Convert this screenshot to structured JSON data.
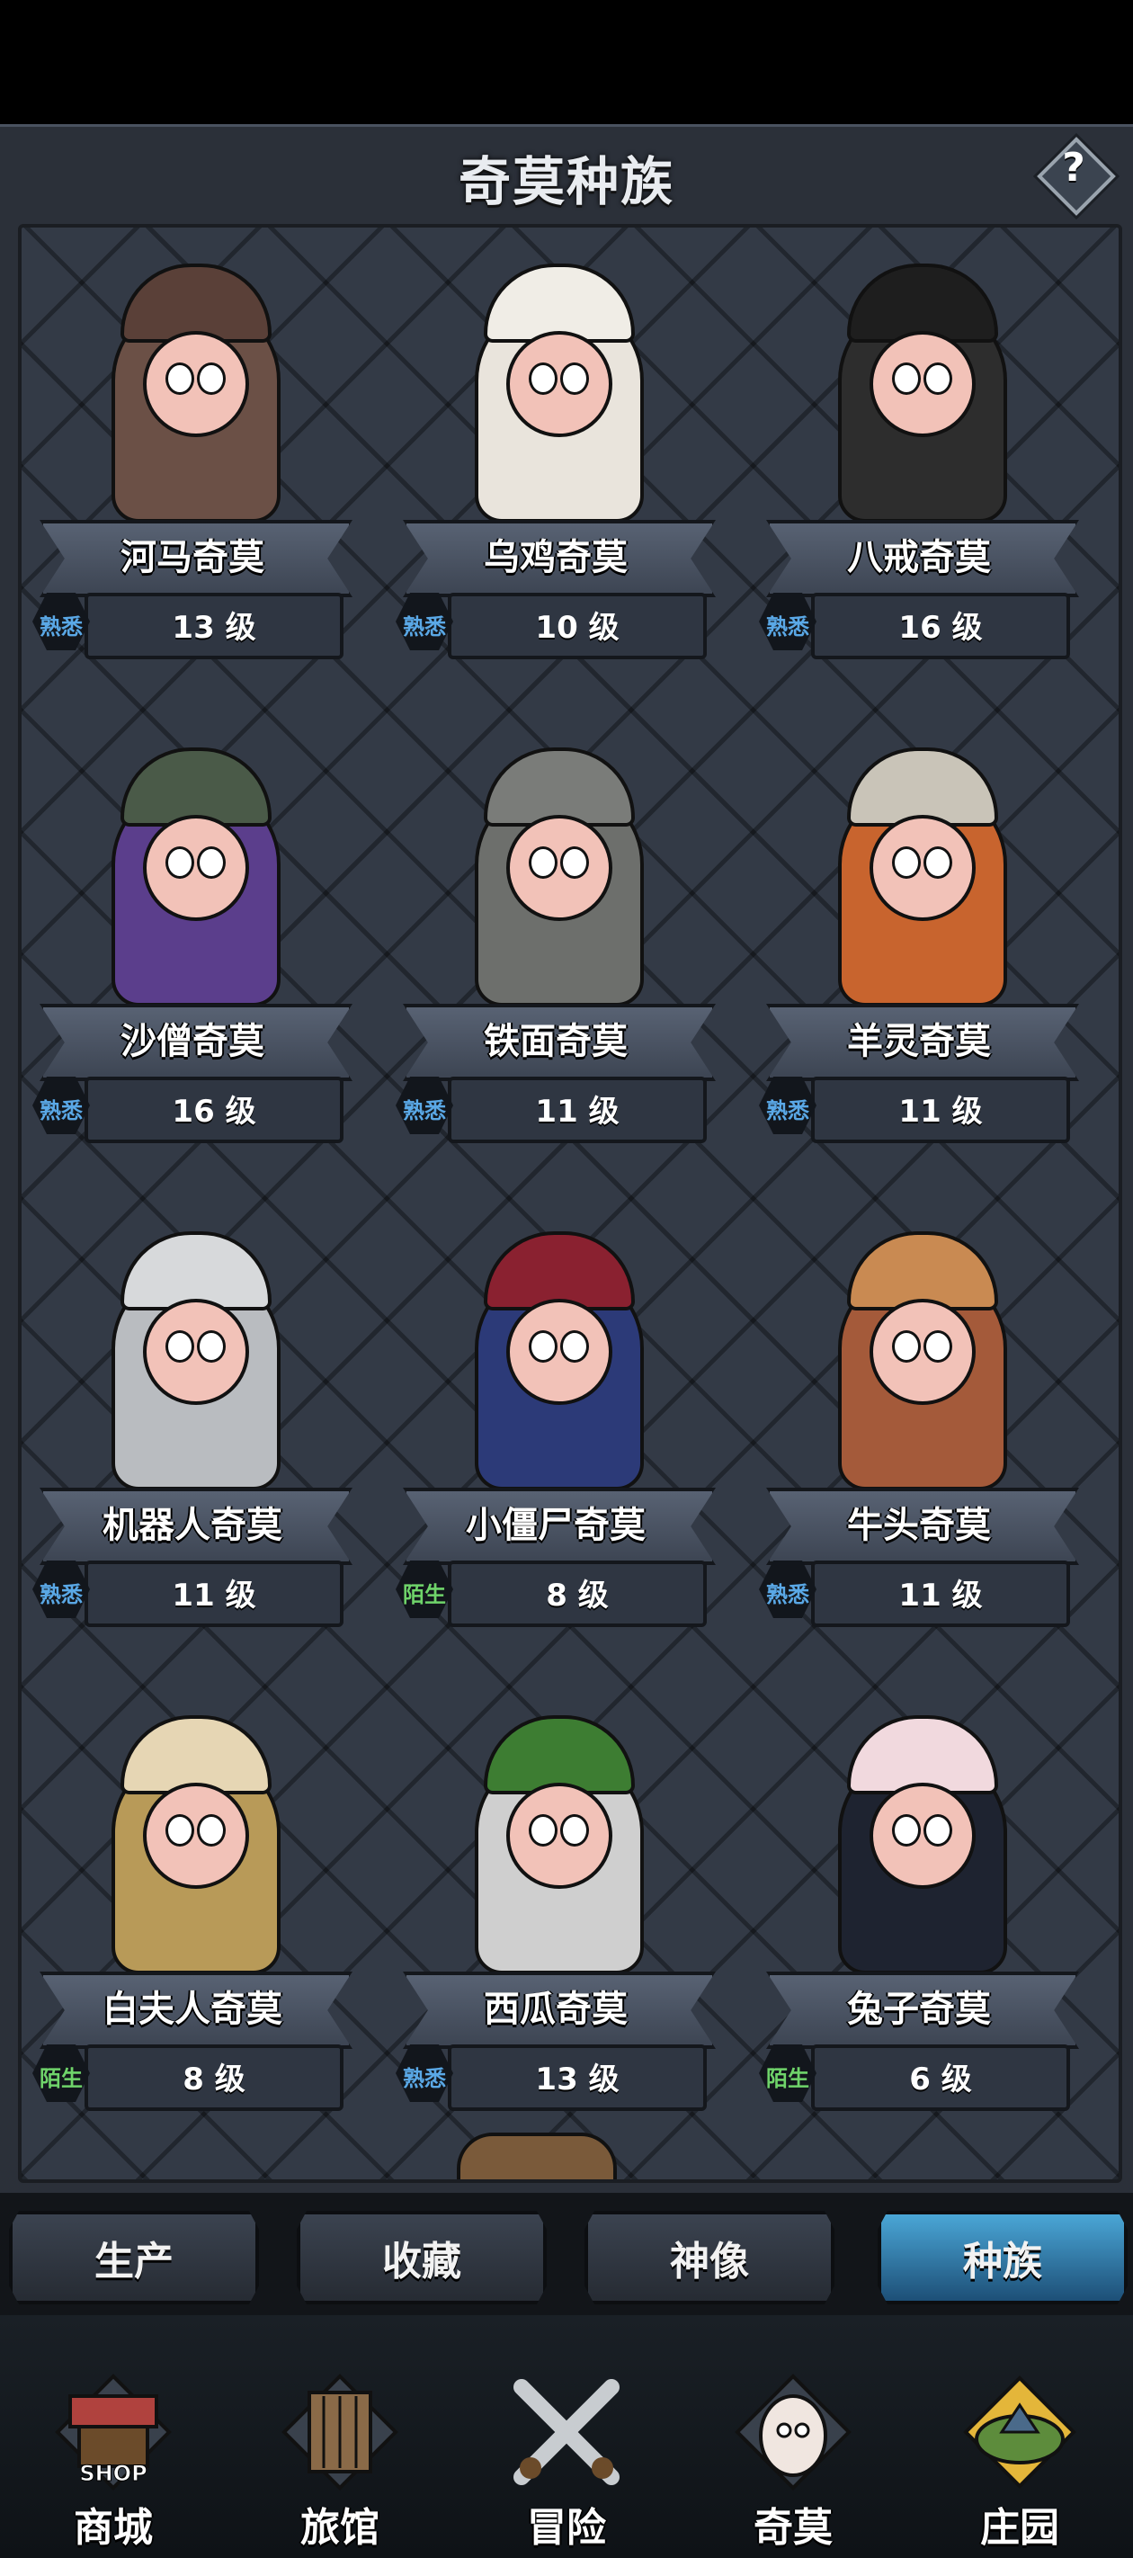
{
  "header": {
    "title": "奇莫种族",
    "help_label": "?"
  },
  "cards": [
    {
      "name": "河马奇莫",
      "level": "13 级",
      "status": "熟悉",
      "status_color": "#5aa8e6",
      "body_color": "#6b5046",
      "hat_color": "#5a4038"
    },
    {
      "name": "乌鸡奇莫",
      "level": "10 级",
      "status": "熟悉",
      "status_color": "#5aa8e6",
      "body_color": "#e9e4dc",
      "hat_color": "#f0ede6"
    },
    {
      "name": "八戒奇莫",
      "level": "16 级",
      "status": "熟悉",
      "status_color": "#5aa8e6",
      "body_color": "#2d2d2d",
      "hat_color": "#1e1e1e"
    },
    {
      "name": "沙僧奇莫",
      "level": "16 级",
      "status": "熟悉",
      "status_color": "#5aa8e6",
      "body_color": "#5b3e8c",
      "hat_color": "#4a5a48"
    },
    {
      "name": "铁面奇莫",
      "level": "11 级",
      "status": "熟悉",
      "status_color": "#5aa8e6",
      "body_color": "#6d6f6c",
      "hat_color": "#7a7c79"
    },
    {
      "name": "羊灵奇莫",
      "level": "11 级",
      "status": "熟悉",
      "status_color": "#5aa8e6",
      "body_color": "#c8642e",
      "hat_color": "#c9c4b8"
    },
    {
      "name": "机器人奇莫",
      "level": "11 级",
      "status": "熟悉",
      "status_color": "#5aa8e6",
      "body_color": "#b9bcc0",
      "hat_color": "#d7d9db"
    },
    {
      "name": "小僵尸奇莫",
      "level": "8 级",
      "status": "陌生",
      "status_color": "#6fd46a",
      "body_color": "#2c3a78",
      "hat_color": "#8a2130"
    },
    {
      "name": "牛头奇莫",
      "level": "11 级",
      "status": "熟悉",
      "status_color": "#5aa8e6",
      "body_color": "#a45a3a",
      "hat_color": "#c98a52"
    },
    {
      "name": "白夫人奇莫",
      "level": "8 级",
      "status": "陌生",
      "status_color": "#6fd46a",
      "body_color": "#b89a58",
      "hat_color": "#e6d6b4"
    },
    {
      "name": "西瓜奇莫",
      "level": "13 级",
      "status": "熟悉",
      "status_color": "#5aa8e6",
      "body_color": "#cfcfcf",
      "hat_color": "#3d7d32"
    },
    {
      "name": "兔子奇莫",
      "level": "6 级",
      "status": "陌生",
      "status_color": "#6fd46a",
      "body_color": "#1e2330",
      "hat_color": "#f1d9de"
    }
  ],
  "tabs": [
    {
      "label": "生产",
      "active": false
    },
    {
      "label": "收藏",
      "active": false
    },
    {
      "label": "神像",
      "active": false
    },
    {
      "label": "种族",
      "active": true
    }
  ],
  "nav": [
    {
      "label": "商城",
      "icon": "shop-icon"
    },
    {
      "label": "旅馆",
      "icon": "inn-icon"
    },
    {
      "label": "冒险",
      "icon": "crossed-swords-icon"
    },
    {
      "label": "奇莫",
      "icon": "qimo-character-icon"
    },
    {
      "label": "庄园",
      "icon": "manor-island-icon"
    }
  ],
  "shop_sign": "SHOP"
}
